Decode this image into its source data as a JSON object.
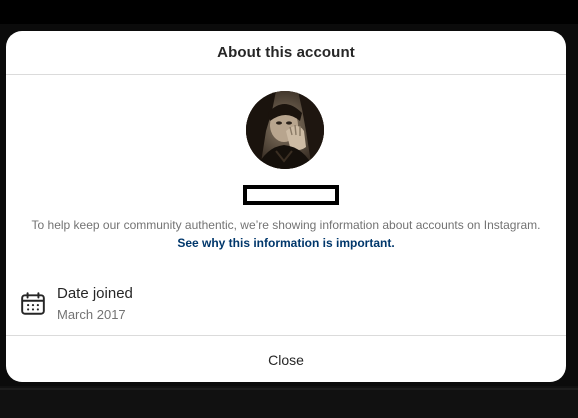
{
  "modal": {
    "title": "About this account"
  },
  "profile": {
    "username_redacted": true
  },
  "info": {
    "text": "To help keep our community authentic, we’re showing information about accounts on Instagram. ",
    "link_label": "See why this information is important."
  },
  "details": [
    {
      "icon": "calendar-icon",
      "label": "Date joined",
      "value": "March 2017"
    }
  ],
  "footer": {
    "close_label": "Close"
  },
  "colors": {
    "link": "#00376b",
    "text_primary": "#262626",
    "text_secondary": "#737373",
    "divider": "#dbdbdb"
  }
}
